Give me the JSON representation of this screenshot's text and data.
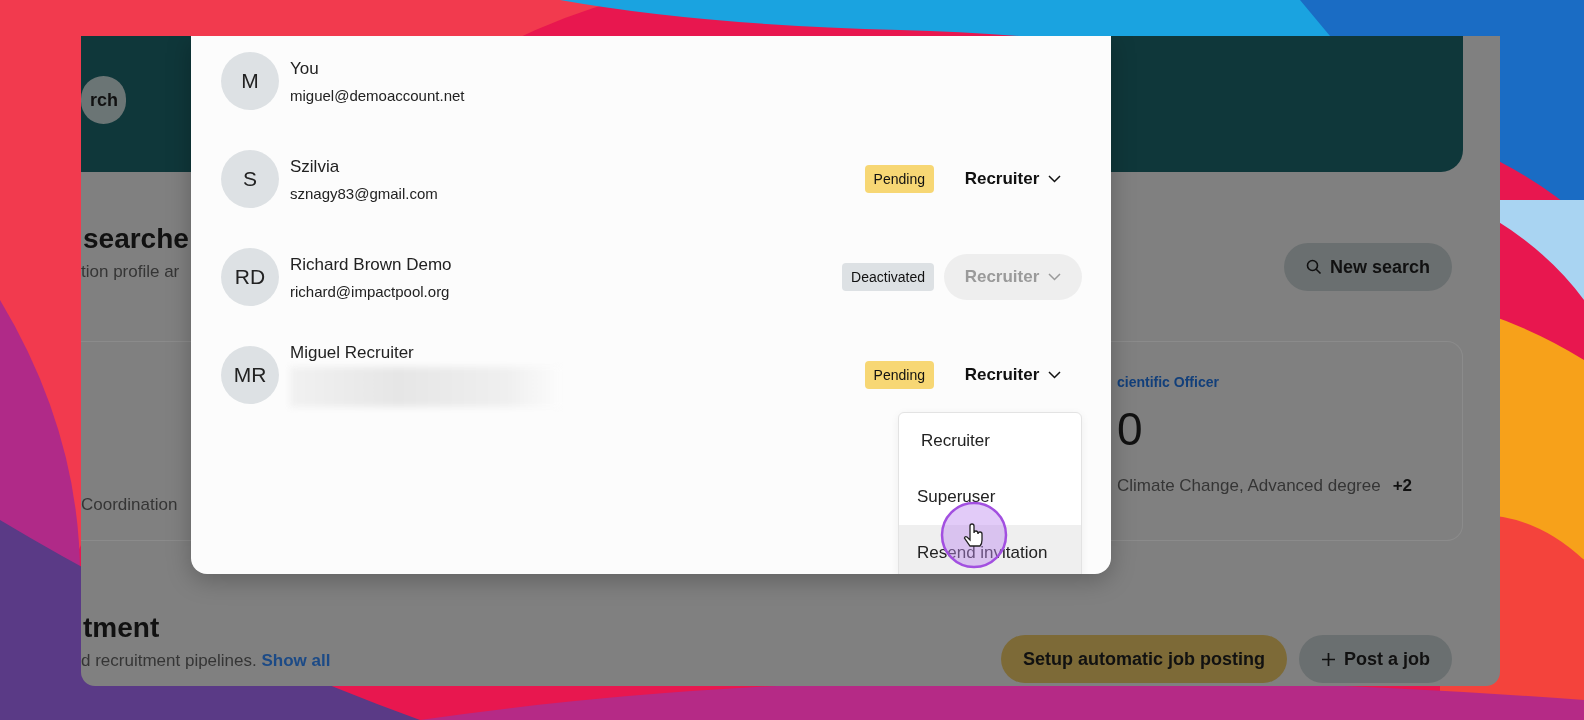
{
  "background": {
    "banner_button": "rch",
    "heading": "searche",
    "subtitle": "tion profile ar",
    "new_search_button": "New search",
    "card": {
      "link": "cientific Officer",
      "count": "0",
      "left_text": "Coordination",
      "tags": "Climate Change, Advanced degree",
      "more": "+2"
    },
    "section_heading": "tment",
    "section_text": "d recruitment pipelines.",
    "section_link": "Show all",
    "buttons": [
      {
        "label": "Setup automatic job posting",
        "kind": "primary"
      },
      {
        "label": "Post a job",
        "kind": "add"
      }
    ]
  },
  "members": [
    {
      "initials": "M",
      "name": "You",
      "email": "miguel@demoaccount.net"
    },
    {
      "initials": "S",
      "name": "Szilvia",
      "email": "sznagy83@gmail.com",
      "status": "Pending",
      "color": "#f7d774",
      "role": "Recruiter",
      "disabled": false
    },
    {
      "initials": "RD",
      "name": "Richard Brown Demo",
      "email": "richard@impactpool.org",
      "status": "Deactivated",
      "color": "#dde1e4",
      "role": "Recruiter",
      "disabled": true
    },
    {
      "initials": "MR",
      "name": "Miguel Recruiter",
      "status": "Pending",
      "color": "#f7d774",
      "role": "Recruiter",
      "disabled": false,
      "menu_open": true
    }
  ],
  "role_menu": {
    "items": [
      {
        "label": "Recruiter",
        "hovered": false
      },
      {
        "label": "Superuser",
        "hovered": false
      },
      {
        "label": "Resend invitation",
        "hovered": true
      }
    ]
  }
}
